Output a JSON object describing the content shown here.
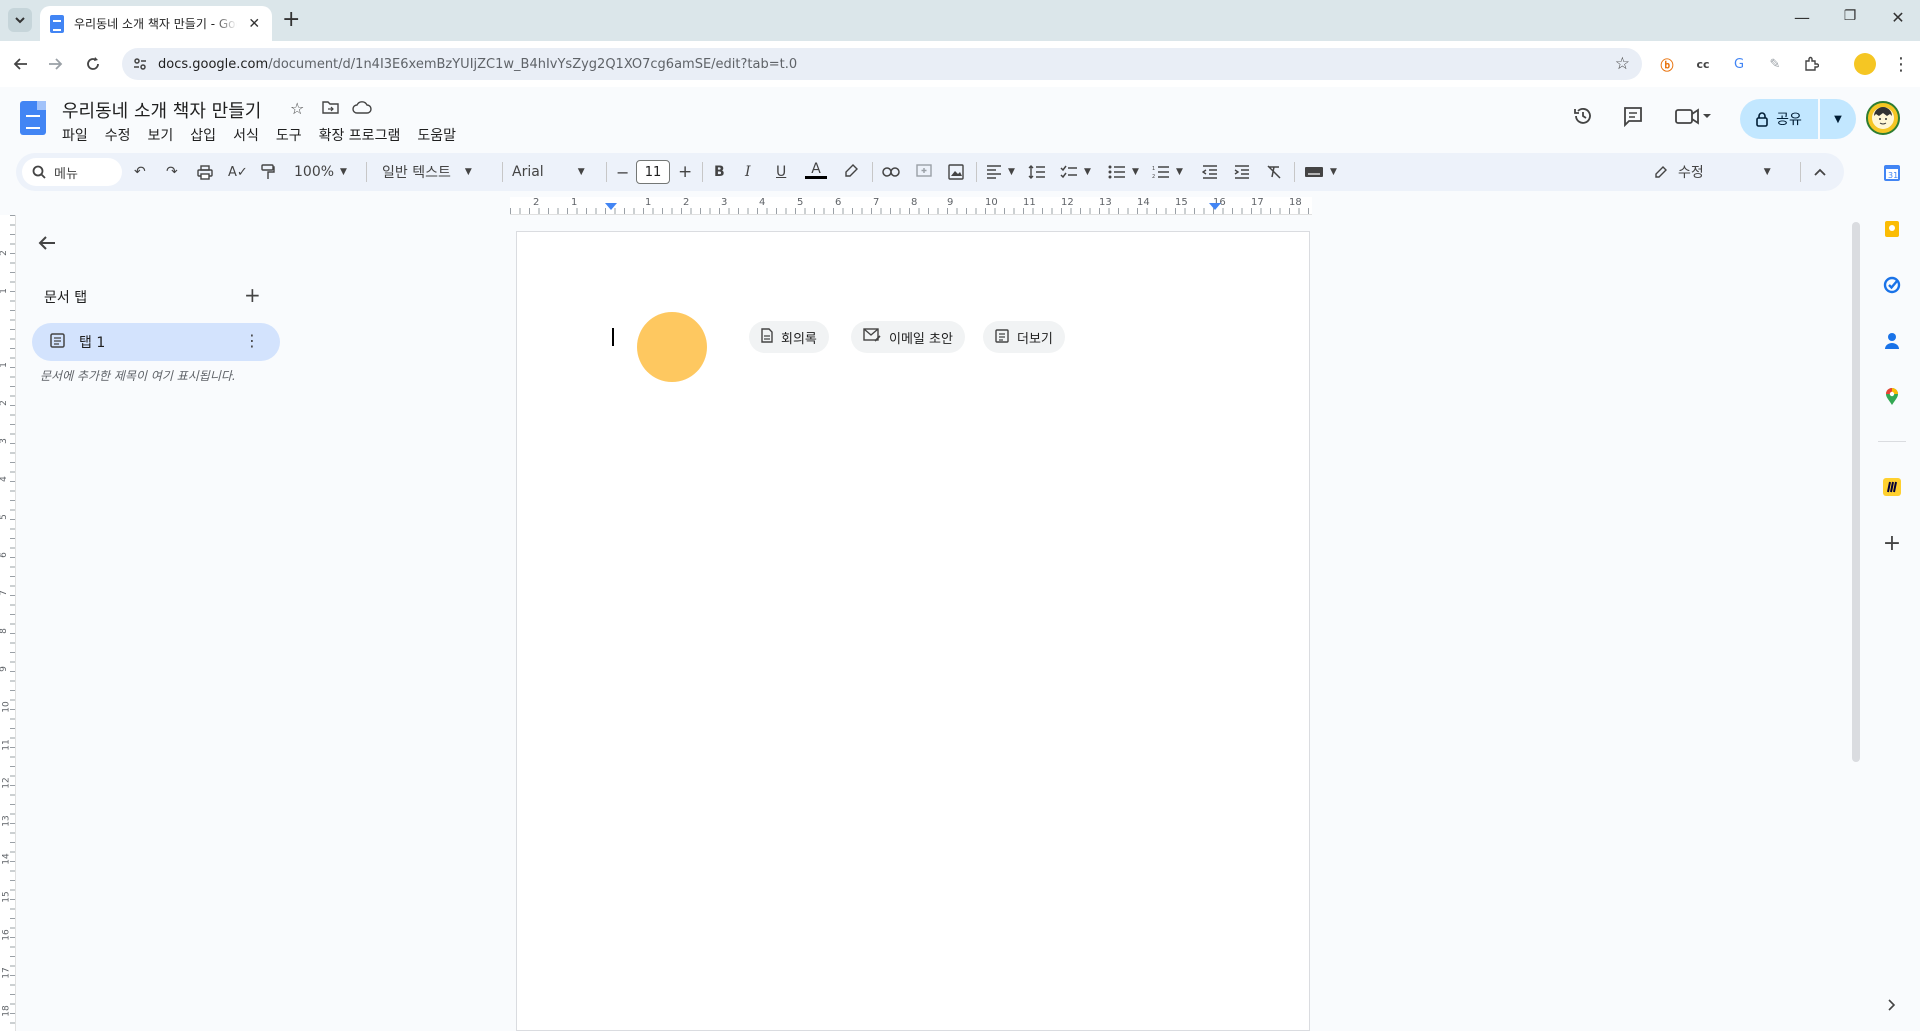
{
  "browser": {
    "tab_title": "우리동네 소개 책자 만들기 - Google Docs",
    "tab_close": "✕",
    "new_tab": "+",
    "url_domain": "docs.google.com",
    "url_path": "/document/d/1n4I3E6xemBzYUIjZC1w_B4hIvYsZyg2Q1XO7cg6amSE/edit?tab=t.0",
    "window_controls": [
      "—",
      "❐",
      "✕"
    ],
    "extension_icons": [
      "b-extension-icon",
      "cc-extension-icon",
      "translate-extension-icon",
      "eraser-extension-icon",
      "puzzle-extension-icon",
      "profile-extension-icon"
    ]
  },
  "doc": {
    "title": "우리동네 소개 책자 만들기",
    "menu": [
      "파일",
      "수정",
      "보기",
      "삽입",
      "서식",
      "도구",
      "확장 프로그램",
      "도움말"
    ],
    "share_label": "공유"
  },
  "toolbar": {
    "search_placeholder": "메뉴",
    "zoom": "100%",
    "style": "일반 텍스트",
    "font": "Arial",
    "font_size": "11",
    "mode": "수정"
  },
  "ruler": {
    "h_labels": [
      "2",
      "1",
      "1",
      "2",
      "3",
      "4",
      "5",
      "6",
      "7",
      "8",
      "9",
      "10",
      "11",
      "12",
      "13",
      "14",
      "15",
      "16",
      "17",
      "18"
    ],
    "v_labels": [
      "2",
      "1",
      "1",
      "2",
      "3",
      "4",
      "5",
      "6",
      "7",
      "8",
      "9",
      "10",
      "11",
      "12",
      "13",
      "14",
      "15",
      "16",
      "17",
      "18"
    ]
  },
  "sidebar": {
    "heading": "문서 탭",
    "tab_label": "탭 1",
    "hint": "문서에 추가한 제목이 여기 표시됩니다."
  },
  "page": {
    "chips": [
      "회의록",
      "이메일 초안",
      "더보기"
    ]
  },
  "colors": {
    "accent": "#4285f4",
    "share_bg": "#c2e7ff",
    "tab_selected": "#d3e3fd",
    "blob": "#fec860",
    "toolbar_bg": "#edf2fa"
  }
}
